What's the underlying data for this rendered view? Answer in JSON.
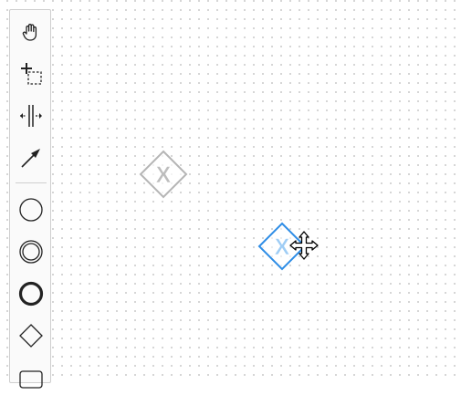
{
  "palette": {
    "tools": [
      {
        "name": "hand-tool",
        "icon": "hand-icon"
      },
      {
        "name": "lasso-tool",
        "icon": "lasso-icon"
      },
      {
        "name": "space-tool",
        "icon": "space-tool-icon"
      },
      {
        "name": "connect-tool",
        "icon": "connect-arrow-icon"
      },
      {
        "name": "create-start-event",
        "icon": "start-event-icon"
      },
      {
        "name": "create-intermediate-event",
        "icon": "intermediate-event-icon"
      },
      {
        "name": "create-end-event",
        "icon": "end-event-icon"
      },
      {
        "name": "create-gateway",
        "icon": "gateway-icon"
      },
      {
        "name": "create-task",
        "icon": "task-icon"
      }
    ]
  },
  "diagram": {
    "gateways": [
      {
        "name": "exclusive-gateway-ghost",
        "marker": "X",
        "state": "faded",
        "color": "#b5b5b5"
      },
      {
        "name": "exclusive-gateway-selected",
        "marker": "X",
        "state": "selected",
        "color": "#2e8de6"
      }
    ],
    "cursor": "move-cursor-icon"
  },
  "colors": {
    "accent": "#2e8de6",
    "faded": "#b5b5b5",
    "icon": "#222222",
    "palette_bg": "#fafafa",
    "palette_border": "#cfcfcf"
  }
}
